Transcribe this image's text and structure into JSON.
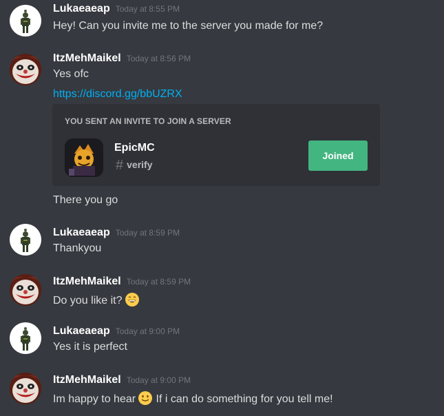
{
  "messages": [
    {
      "username": "Lukaeaeap",
      "timestamp": "Today at 8:55 PM",
      "text": "Hey! Can you invite me to  the server you made for me?"
    },
    {
      "username": "ItzMehMaikel",
      "timestamp": "Today at 8:56 PM",
      "text": "Yes ofc",
      "link": "https://discord.gg/bbUZRX",
      "after_text": "There you go"
    },
    {
      "username": "Lukaeaeap",
      "timestamp": "Today at 8:59 PM",
      "text": "Thankyou"
    },
    {
      "username": "ItzMehMaikel",
      "timestamp": "Today at 8:59 PM",
      "text": "Do you like it?"
    },
    {
      "username": "Lukaeaeap",
      "timestamp": "Today at 9:00 PM",
      "text": "Yes it is perfect"
    },
    {
      "username": "ItzMehMaikel",
      "timestamp": "Today at 9:00 PM",
      "text_before": "Im happy to hear",
      "text_after": "If i can do something for you tell me!"
    }
  ],
  "invite": {
    "heading": "YOU SENT AN INVITE TO JOIN A SERVER",
    "server_name": "EpicMC",
    "channel_name": "verify",
    "button_label": "Joined"
  },
  "emojis": [
    "grinning-emoji",
    "slight-smile-emoji"
  ],
  "colors": {
    "background": "#36393f",
    "embed_background": "#2f3136",
    "link": "#00b0f4",
    "joined_button": "#43b581",
    "username": "#ffffff",
    "timestamp": "#72767d"
  }
}
